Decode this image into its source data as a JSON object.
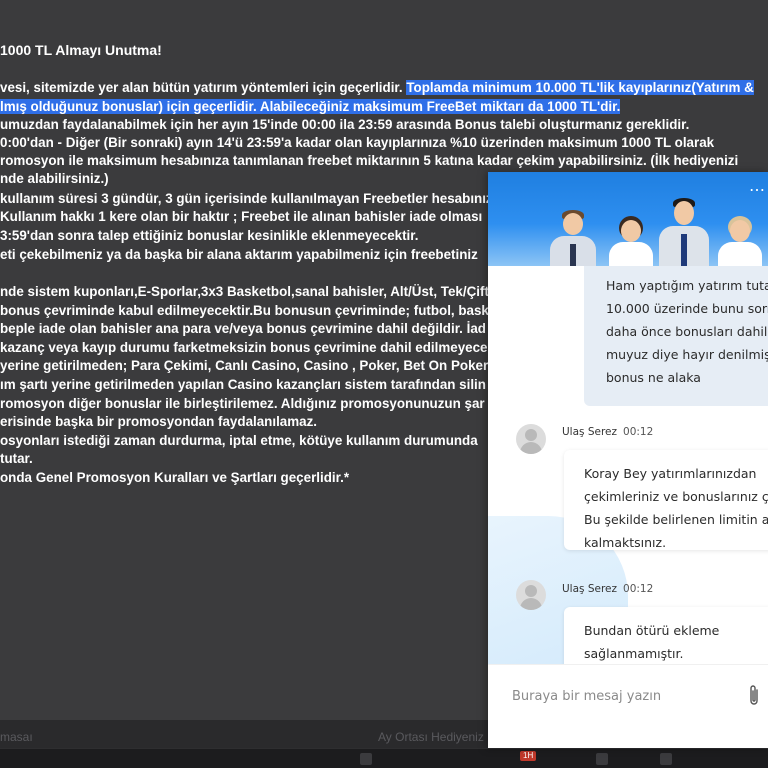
{
  "promo": {
    "title": "1000 TL Almayı Unutma!",
    "lines": [
      {
        "pre": "vesi, sitemizde yer alan bütün yatırım yöntemleri için geçerlidir. ",
        "hl": "Toplamda minimum 10.000 TL'lik kayıplarınız(Yatırım &",
        "post": ""
      },
      {
        "pre": "",
        "hl": "lmış olduğunuz bonuslar) için geçerlidir. Alabileceğiniz maksimum FreeBet miktarı da 1000 TL'dir.",
        "post": ""
      },
      {
        "pre": "umuzdan faydalanabilmek için her ayın 15'inde 00:00 ila 23:59 arasında Bonus talebi oluşturmanız gereklidir.",
        "hl": "",
        "post": ""
      },
      {
        "pre": "0:00'dan - Diğer (Bir sonraki) ayın 14'ü 23:59'a kadar olan kayıplarınıza %10 üzerinden maksimum 1000 TL olarak",
        "hl": "",
        "post": ""
      },
      {
        "pre": "romosyon ile maksimum hesabınıza tanımlanan freebet miktarının 5 katına kadar çekim yapabilirsiniz. (İlk hediyenizi",
        "hl": "",
        "post": ""
      },
      {
        "pre": "nde alabilirsiniz.)",
        "hl": "",
        "post": ""
      },
      {
        "pre": "kullanım süresi 3 gündür, 3 gün içerisinde kullanılmayan Freebetler hesabınızd",
        "hl": "",
        "post": ""
      },
      {
        "pre": "Kullanım hakkı 1 kere olan bir haktır ; Freebet ile alınan bahisler iade olması",
        "hl": "",
        "post": ""
      },
      {
        "pre": "3:59'dan sonra talep ettiğiniz bonuslar kesinlikle eklenmeyecektir.",
        "hl": "",
        "post": ""
      },
      {
        "pre": "eti çekebilmeniz ya da başka bir alana aktarım yapabilmeniz için freebetiniz",
        "hl": "",
        "post": ""
      },
      {
        "pre": "",
        "hl": "",
        "post": ""
      },
      {
        "pre": "nde sistem kuponları,E-Sporlar,3x3 Basketbol,sanal bahisler, Alt/Üst, Tek/Çift",
        "hl": "",
        "post": ""
      },
      {
        "pre": "bonus çevriminde kabul edilmeyecektir.Bu bonusun çevriminde; futbol, baske",
        "hl": "",
        "post": ""
      },
      {
        "pre": "beple iade olan bahisler ana para ve/veya bonus çevrimine dahil değildir. İad",
        "hl": "",
        "post": ""
      },
      {
        "pre": " kazanç veya kayıp durumu farketmeksizin bonus çevrimine dahil edilmeyece",
        "hl": "",
        "post": ""
      },
      {
        "pre": "yerine getirilmeden; Para Çekimi, Canlı Casino, Casino , Poker, Bet On Poker",
        "hl": "",
        "post": ""
      },
      {
        "pre": "ım şartı yerine getirilmeden yapılan Casino kazançları sistem tarafından silin",
        "hl": "",
        "post": ""
      },
      {
        "pre": "romosyon diğer bonuslar ile birleştirilemez. Aldığınız promosyonunuzun şar",
        "hl": "",
        "post": ""
      },
      {
        "pre": "erisinde başka bir promosyondan faydalanılamaz.",
        "hl": "",
        "post": ""
      },
      {
        "pre": "osyonları istediği zaman durdurma, iptal etme, kötüye kullanım durumunda",
        "hl": "",
        "post": ""
      },
      {
        "pre": " tutar.",
        "hl": "",
        "post": ""
      },
      {
        "pre": "onda Genel Promosyon Kuralları ve Şartları geçerlidir.*",
        "hl": "",
        "post": ""
      }
    ]
  },
  "bottom": {
    "left_ghost": "masaı",
    "right_ghost": "Ay Ortası Hediyeniz"
  },
  "taskbar": {
    "badge": "1H"
  },
  "chat": {
    "more_label": "⋯",
    "user_message_lines": [
      "Ham yaptığım yatırım tutarı",
      "10.000 üzerinde bunu sorm",
      "daha önce bonusları dahil e",
      "muyuz diye hayır denilmişti",
      "bonus ne alaka"
    ],
    "messages": [
      {
        "sender": "Ulaş Serez",
        "time": "00:12",
        "lines": [
          "Koray Bey yatırımlarınızdan",
          "çekimleriniz ve bonuslarınız çık",
          "Bu şekilde belirlenen limitin alt",
          "kalmaktsınız."
        ]
      },
      {
        "sender": "Ulaş Serez",
        "time": "00:12",
        "lines": [
          "Bundan ötürü ekleme",
          "sağlanmamıştır."
        ]
      }
    ],
    "input_placeholder": "Buraya bir mesaj yazın",
    "colors": {
      "header": "#2e8ff0",
      "user_bubble": "#e6edf5",
      "highlight": "#2f6fe8"
    }
  }
}
